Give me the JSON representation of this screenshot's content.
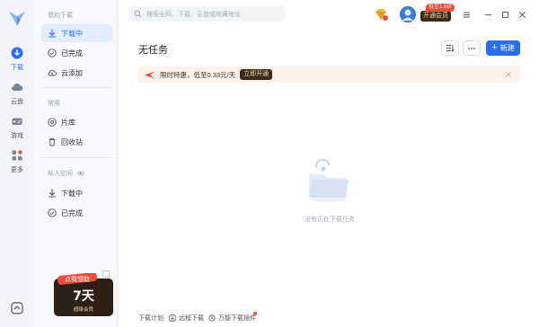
{
  "rail": {
    "items": [
      {
        "label": "下载",
        "icon": "download-icon",
        "active": true
      },
      {
        "label": "云盘",
        "icon": "cloud-icon",
        "active": false
      },
      {
        "label": "游戏",
        "icon": "gamepad-icon",
        "active": false
      },
      {
        "label": "更多",
        "icon": "more-apps-icon",
        "active": false
      }
    ]
  },
  "nav": {
    "section_my_downloads": "我的下载",
    "items": [
      {
        "label": "下载中",
        "icon": "download-arrow-icon",
        "active": true
      },
      {
        "label": "已完成",
        "icon": "check-circle-icon",
        "active": false
      },
      {
        "label": "云添加",
        "icon": "cloud-add-icon",
        "active": false
      }
    ],
    "section_common": "常用",
    "common_items": [
      {
        "label": "片库",
        "icon": "film-icon"
      },
      {
        "label": "回收站",
        "icon": "trash-icon"
      }
    ],
    "section_private": "私人空间",
    "private_items": [
      {
        "label": "下载中",
        "icon": "download-arrow-icon"
      },
      {
        "label": "已完成",
        "icon": "check-circle-icon"
      }
    ],
    "promo": {
      "tag": "点我领取",
      "days": "7天",
      "subtitle": "超级会员"
    }
  },
  "topbar": {
    "search_placeholder": "搜索全网、下载、云盘或收藏地址",
    "discount_badge": "低至1.6折",
    "open_vip": "开通会员"
  },
  "main": {
    "title": "无任务",
    "new_button": "新建",
    "banner": {
      "text": "限时特惠，低至0.33元/天",
      "cta": "立即开通"
    },
    "empty_text": "没有正在下载任务"
  },
  "footer": {
    "items": [
      "下载计划",
      "远程下载",
      "万能下载插件"
    ]
  },
  "colors": {
    "accent": "#2a6ef0",
    "vip_dark": "#3b2a1a",
    "vip_gold": "#f7d9a8",
    "badge_red": "#f24a3a"
  }
}
